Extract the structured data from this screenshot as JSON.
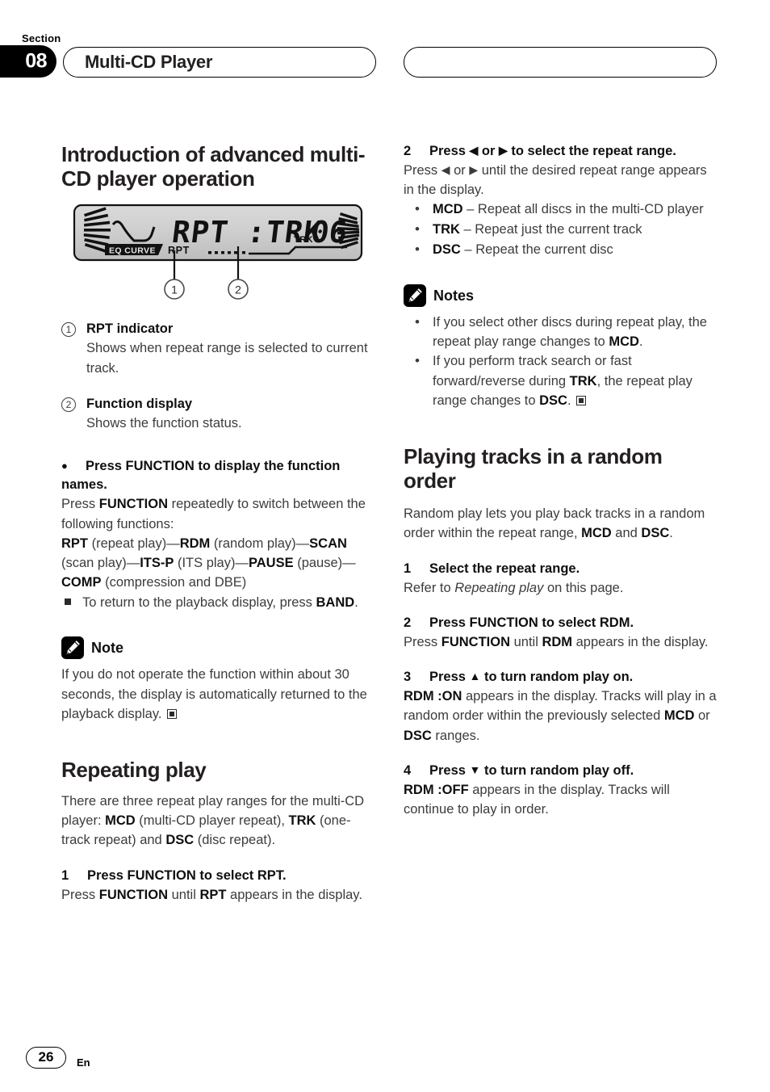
{
  "header": {
    "section_label": "Section",
    "section_number": "08",
    "title": "Multi-CD Player",
    "right_pill_title": ""
  },
  "left_column": {
    "heading": "Introduction of advanced multi-CD player operation",
    "display_illustration": {
      "main_text": "RPT :TRK",
      "track_label": "TRK",
      "track_number": "06",
      "eq_label": "EQ CURVE",
      "rpt_indicator": "RPT",
      "callout_1": "1",
      "callout_2": "2"
    },
    "callouts": [
      {
        "number": "1",
        "heading": "RPT indicator",
        "body": "Shows when repeat range is selected to current track."
      },
      {
        "number": "2",
        "heading": "Function display",
        "body": "Shows the function status."
      }
    ],
    "function_step": {
      "heading": "Press FUNCTION to display the function names.",
      "line1_pre": "Press ",
      "line1_bold": "FUNCTION",
      "line1_post": " repeatedly to switch between the following functions:",
      "sequence": [
        {
          "bold": "RPT",
          "plain": " (repeat play)—"
        },
        {
          "bold": "RDM",
          "plain": " (random play)—"
        },
        {
          "bold": "SCAN",
          "plain": " (scan play)—"
        },
        {
          "bold": "ITS-P",
          "plain": " (ITS play)—"
        },
        {
          "bold": "PAUSE",
          "plain": " (pause)—"
        },
        {
          "bold": "COMP",
          "plain": " (compression and DBE)"
        }
      ],
      "sub_note_pre": "To return to the playback display, press ",
      "sub_note_bold": "BAND",
      "sub_note_post": "."
    },
    "note": {
      "label": "Note",
      "icon": "pencil-icon",
      "body": "If you do not operate the function within about 30 seconds, the display is automatically returned to the playback display."
    },
    "repeating_play": {
      "heading": "Repeating play",
      "intro_p1": "There are three repeat play ranges for the multi-CD player: ",
      "intro_b1": "MCD",
      "intro_p2": " (multi-CD player repeat), ",
      "intro_b2": "TRK",
      "intro_p3": " (one-track repeat) and ",
      "intro_b3": "DSC",
      "intro_p4": " (disc repeat).",
      "step1": {
        "number": "1",
        "heading": "Press FUNCTION to select RPT.",
        "body_p1": "Press ",
        "body_b1": "FUNCTION",
        "body_p2": " until ",
        "body_b2": "RPT",
        "body_p3": " appears in the display."
      }
    }
  },
  "right_column": {
    "step2": {
      "number": "2",
      "heading_pre": "Press ",
      "heading_arrow_left": "◀",
      "heading_mid": " or ",
      "heading_arrow_right": "▶",
      "heading_post": " to select the repeat range.",
      "body_p1": "Press ",
      "body_arrow_left": "◀",
      "body_mid": " or ",
      "body_arrow_right": "▶",
      "body_p2": " until the desired repeat range appears in the display.",
      "options": [
        {
          "bold": "MCD",
          "text": " – Repeat all discs in the multi-CD player"
        },
        {
          "bold": "TRK",
          "text": " – Repeat just the current track"
        },
        {
          "bold": "DSC",
          "text": " – Repeat the current disc"
        }
      ]
    },
    "notes": {
      "label": "Notes",
      "icon": "pencil-icon",
      "items": [
        {
          "p1": "If you select other discs during repeat play, the repeat play range changes to ",
          "b1": "MCD",
          "p2": "."
        },
        {
          "p1": "If you perform track search or fast forward/reverse during ",
          "b1": "TRK",
          "p2": ", the repeat play range changes to ",
          "b2": "DSC",
          "p3": "."
        }
      ]
    },
    "random_order": {
      "heading": "Playing tracks in a random order",
      "intro_p1": "Random play lets you play back tracks in a random order within the repeat range, ",
      "intro_b1": "MCD",
      "intro_p2": " and ",
      "intro_b2": "DSC",
      "intro_p3": ".",
      "steps": [
        {
          "number": "1",
          "heading": "Select the repeat range.",
          "body_p1": "Refer to ",
          "body_i1": "Repeating play",
          "body_p2": " on this page."
        },
        {
          "number": "2",
          "heading": "Press FUNCTION to select RDM.",
          "body_p1": "Press ",
          "body_b1": "FUNCTION",
          "body_p2": " until ",
          "body_b2": "RDM",
          "body_p3": " appears in the display."
        },
        {
          "number": "3",
          "heading_pre": "Press ",
          "heading_arrow": "▲",
          "heading_post": " to turn random play on.",
          "body_b1": "RDM :ON",
          "body_p1": " appears in the display. Tracks will play in a random order within the previously selected ",
          "body_b2": "MCD",
          "body_p2": " or ",
          "body_b3": "DSC",
          "body_p3": " ranges."
        },
        {
          "number": "4",
          "heading_pre": "Press ",
          "heading_arrow": "▼",
          "heading_post": " to turn random play off.",
          "body_b1": "RDM :OFF",
          "body_p1": " appears in the display. Tracks will continue to play in order."
        }
      ]
    }
  },
  "footer": {
    "page_number": "26",
    "language": "En"
  }
}
